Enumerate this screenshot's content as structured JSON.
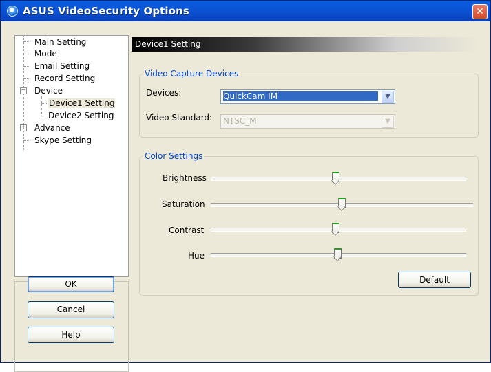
{
  "window": {
    "title": "ASUS VideoSecurity Options",
    "close_icon": "close-icon",
    "accent": "#0a5fe0",
    "close_color": "#d24a2b"
  },
  "tree": {
    "items": [
      {
        "label": "Main Setting"
      },
      {
        "label": "Mode"
      },
      {
        "label": "Email Setting"
      },
      {
        "label": "Record Setting"
      },
      {
        "label": "Device"
      },
      {
        "label": "Device1 Setting"
      },
      {
        "label": "Device2 Setting"
      },
      {
        "label": "Advance"
      },
      {
        "label": "Skype Setting"
      }
    ],
    "selected": "Device1 Setting"
  },
  "buttons": {
    "ok": "OK",
    "cancel": "Cancel",
    "help": "Help",
    "default": "Default"
  },
  "panel": {
    "header": "Device1 Setting",
    "video_capture": {
      "group_label": "Video Capture Devices",
      "devices_label": "Devices:",
      "devices_value": "QuickCam IM",
      "standard_label": "Video Standard:",
      "standard_value": "NTSC_M"
    },
    "color": {
      "group_label": "Color Settings",
      "sliders": [
        {
          "label": "Brightness",
          "value": 0.49
        },
        {
          "label": "Saturation",
          "value": 0.49
        },
        {
          "label": "Contrast",
          "value": 0.49
        },
        {
          "label": "Hue",
          "value": 0.5
        }
      ]
    }
  }
}
